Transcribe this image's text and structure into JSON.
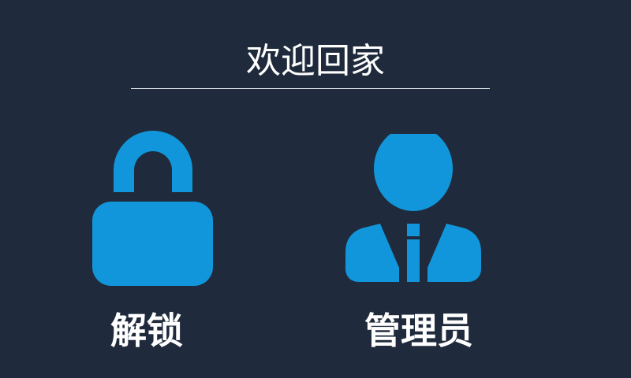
{
  "header": {
    "title": "欢迎回家"
  },
  "actions": {
    "unlock": {
      "label": "解锁",
      "icon": "padlock-icon"
    },
    "admin": {
      "label": "管理员",
      "icon": "administrator-person-icon"
    }
  },
  "theme": {
    "background": "#1f2b3c",
    "accent": "#1296db",
    "text": "#ffffff",
    "divider": "#e6e9ee"
  }
}
